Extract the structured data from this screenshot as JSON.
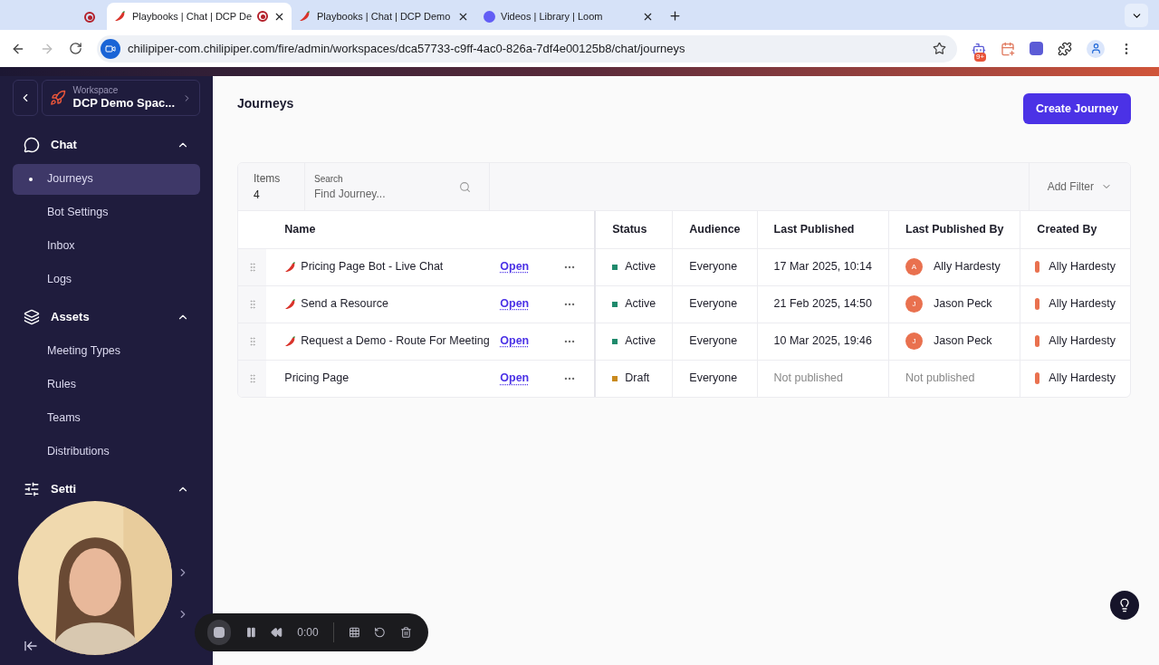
{
  "browser": {
    "tabs": [
      {
        "title": "Playbooks | Chat | DCP De",
        "selected": true,
        "recording": true
      },
      {
        "title": "Playbooks | Chat | DCP Demo",
        "selected": false,
        "recording": false
      },
      {
        "title": "Videos | Library | Loom",
        "selected": false,
        "recording": false
      }
    ],
    "url": "chilipiper-com.chilipiper.com/fire/admin/workspaces/dca57733-c9ff-4ac0-826a-7df4e00125b8/chat/journeys",
    "extension_badge": "9+"
  },
  "workspace": {
    "label": "Workspace",
    "name": "DCP Demo Spac..."
  },
  "sidebar": {
    "sections": [
      {
        "kind": "chat",
        "title": "Chat",
        "expanded": true,
        "items": [
          {
            "label": "Journeys",
            "selected": true
          },
          {
            "label": "Bot Settings",
            "selected": false
          },
          {
            "label": "Inbox",
            "selected": false
          },
          {
            "label": "Logs",
            "selected": false
          }
        ]
      },
      {
        "kind": "assets",
        "title": "Assets",
        "expanded": true,
        "items": [
          {
            "label": "Meeting Types",
            "selected": false
          },
          {
            "label": "Rules",
            "selected": false
          },
          {
            "label": "Teams",
            "selected": false
          },
          {
            "label": "Distributions",
            "selected": false
          }
        ]
      },
      {
        "kind": "settings",
        "title": "Setti",
        "expanded": true
      }
    ]
  },
  "page": {
    "title": "Journeys",
    "create_button": "Create Journey"
  },
  "toolbar": {
    "items_label": "Items",
    "items_count": "4",
    "search_label": "Search",
    "search_placeholder": "Find Journey...",
    "filter": "Add Filter"
  },
  "table": {
    "columns": [
      "Name",
      "Status",
      "Audience",
      "Last Published",
      "Last Published By",
      "Created By"
    ],
    "rows": [
      {
        "name": "Pricing Page Bot - Live Chat",
        "pepper": true,
        "open": "Open",
        "status": "Active",
        "color": "#1f8a6c",
        "audience": "Everyone",
        "last_published": "17 Mar 2025, 10:14",
        "published": true,
        "publisher_initial": "A",
        "publisher": "Ally Hardesty",
        "creator": "Ally Hardesty"
      },
      {
        "name": "Send a Resource",
        "pepper": true,
        "open": "Open",
        "status": "Active",
        "color": "#1f8a6c",
        "audience": "Everyone",
        "last_published": "21 Feb 2025, 14:50",
        "published": true,
        "publisher_initial": "J",
        "publisher": "Jason Peck",
        "creator": "Ally Hardesty"
      },
      {
        "name": "Request a Demo - Route For Meeting",
        "pepper": true,
        "open": "Open",
        "status": "Active",
        "color": "#1f8a6c",
        "audience": "Everyone",
        "last_published": "10 Mar 2025, 19:46",
        "published": true,
        "publisher_initial": "J",
        "publisher": "Jason Peck",
        "creator": "Ally Hardesty"
      },
      {
        "name": "Pricing Page",
        "pepper": false,
        "open": "Open",
        "status": "Draft",
        "color": "#c98a1e",
        "audience": "Everyone",
        "last_published": "Not published",
        "published": false,
        "publisher_initial": "",
        "publisher": "Not published",
        "creator": "Ally Hardesty"
      }
    ]
  },
  "recorder": {
    "time": "0:00"
  }
}
